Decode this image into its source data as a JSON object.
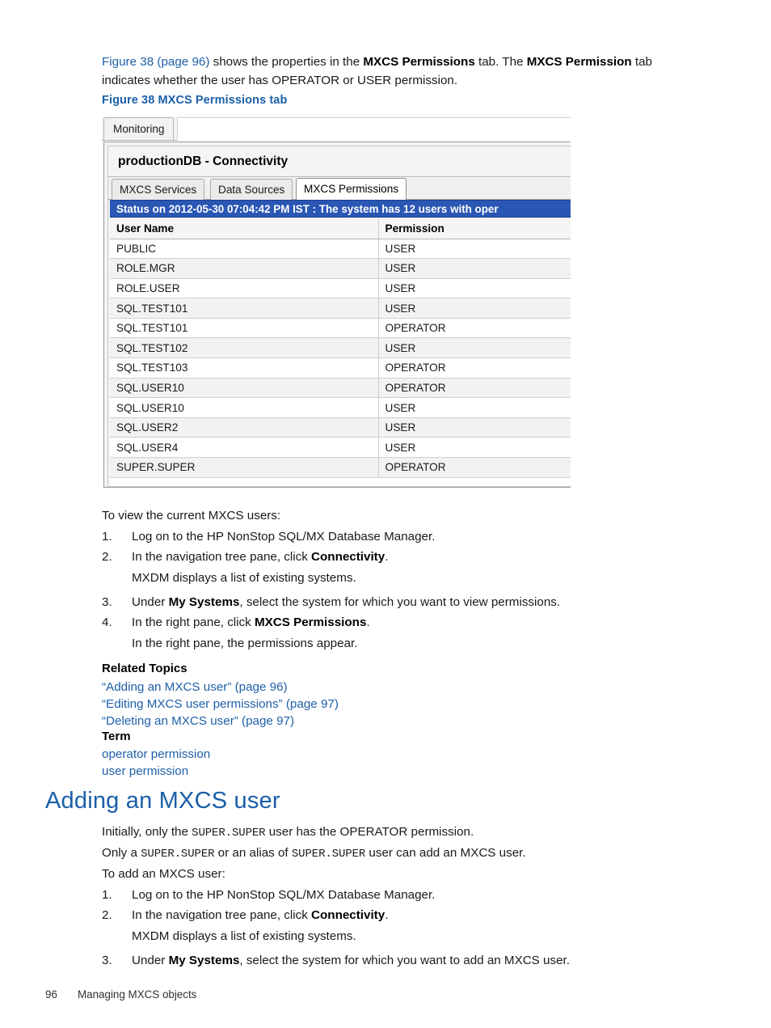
{
  "intro": {
    "link_text": "Figure 38 (page 96)",
    "part1": " shows the properties in the ",
    "bold1": "MXCS Permissions",
    "part2": " tab. The ",
    "bold2": "MXCS Permission",
    "part3": " tab indicates whether the user has OPERATOR or USER permission."
  },
  "figure_caption": "Figure 38 MXCS Permissions tab",
  "figure": {
    "outer_tab": "Monitoring",
    "panel_title": "productionDB - Connectivity",
    "tabs": [
      {
        "label": "MXCS Services",
        "active": false
      },
      {
        "label": "Data Sources",
        "active": false
      },
      {
        "label": "MXCS Permissions",
        "active": true
      }
    ],
    "status_bar": "Status on 2012-05-30 07:04:42 PM IST : The system has 12 users with oper",
    "columns": [
      "User Name",
      "Permission"
    ],
    "rows": [
      [
        "PUBLIC",
        "USER"
      ],
      [
        "ROLE.MGR",
        "USER"
      ],
      [
        "ROLE.USER",
        "USER"
      ],
      [
        "SQL.TEST101",
        "USER"
      ],
      [
        "SQL.TEST101",
        "OPERATOR"
      ],
      [
        "SQL.TEST102",
        "USER"
      ],
      [
        "SQL.TEST103",
        "OPERATOR"
      ],
      [
        "SQL.USER10",
        "OPERATOR"
      ],
      [
        "SQL.USER10",
        "USER"
      ],
      [
        "SQL.USER2",
        "USER"
      ],
      [
        "SQL.USER4",
        "USER"
      ],
      [
        "SUPER.SUPER",
        "OPERATOR"
      ]
    ]
  },
  "view_procedure": {
    "lead": "To view the current MXCS users:",
    "steps": [
      {
        "num": "1.",
        "text_before": "Log on to the HP NonStop SQL/MX Database Manager.",
        "bold": "",
        "text_after": "",
        "sub": ""
      },
      {
        "num": "2.",
        "text_before": "In the navigation tree pane, click ",
        "bold": "Connectivity",
        "text_after": ".",
        "sub": "MXDM displays a list of existing systems."
      },
      {
        "num": "3.",
        "text_before": "Under ",
        "bold": "My Systems",
        "text_after": ", select the system for which you want to view permissions.",
        "sub": ""
      },
      {
        "num": "4.",
        "text_before": "In the right pane, click ",
        "bold": "MXCS Permissions",
        "text_after": ".",
        "sub": "In the right pane, the permissions appear."
      }
    ]
  },
  "related": {
    "heading": "Related Topics",
    "links": [
      "“Adding an MXCS user” (page 96)",
      "“Editing MXCS user permissions” (page 97)",
      "“Deleting an MXCS user” (page 97)"
    ],
    "term_heading": "Term",
    "terms": [
      "operator permission",
      "user permission"
    ]
  },
  "section": {
    "title": "Adding an MXCS user",
    "p1_a": "Initially, only the ",
    "p1_mono": "SUPER.SUPER",
    "p1_b": " user has the OPERATOR permission.",
    "p2_a": "Only a ",
    "p2_mono1": "SUPER.SUPER",
    "p2_b": " or an alias of ",
    "p2_mono2": "SUPER.SUPER",
    "p2_c": " user can add an MXCS user.",
    "p3": "To add an MXCS user:"
  },
  "add_procedure": {
    "steps": [
      {
        "num": "1.",
        "text_before": "Log on to the HP NonStop SQL/MX Database Manager.",
        "bold": "",
        "text_after": "",
        "sub": ""
      },
      {
        "num": "2.",
        "text_before": "In the navigation tree pane, click ",
        "bold": "Connectivity",
        "text_after": ".",
        "sub": "MXDM displays a list of existing systems."
      },
      {
        "num": "3.",
        "text_before": "Under ",
        "bold": "My Systems",
        "text_after": ", select the system for which you want to add an MXCS user.",
        "sub": ""
      }
    ]
  },
  "footer": {
    "page_number": "96",
    "chapter": "Managing MXCS objects"
  },
  "colors": {
    "link_blue": "#1f5fa9",
    "heading_blue": "#1a5fa8",
    "status_blue": "#2a56b4",
    "row_stripe": "#f2f2f2"
  }
}
